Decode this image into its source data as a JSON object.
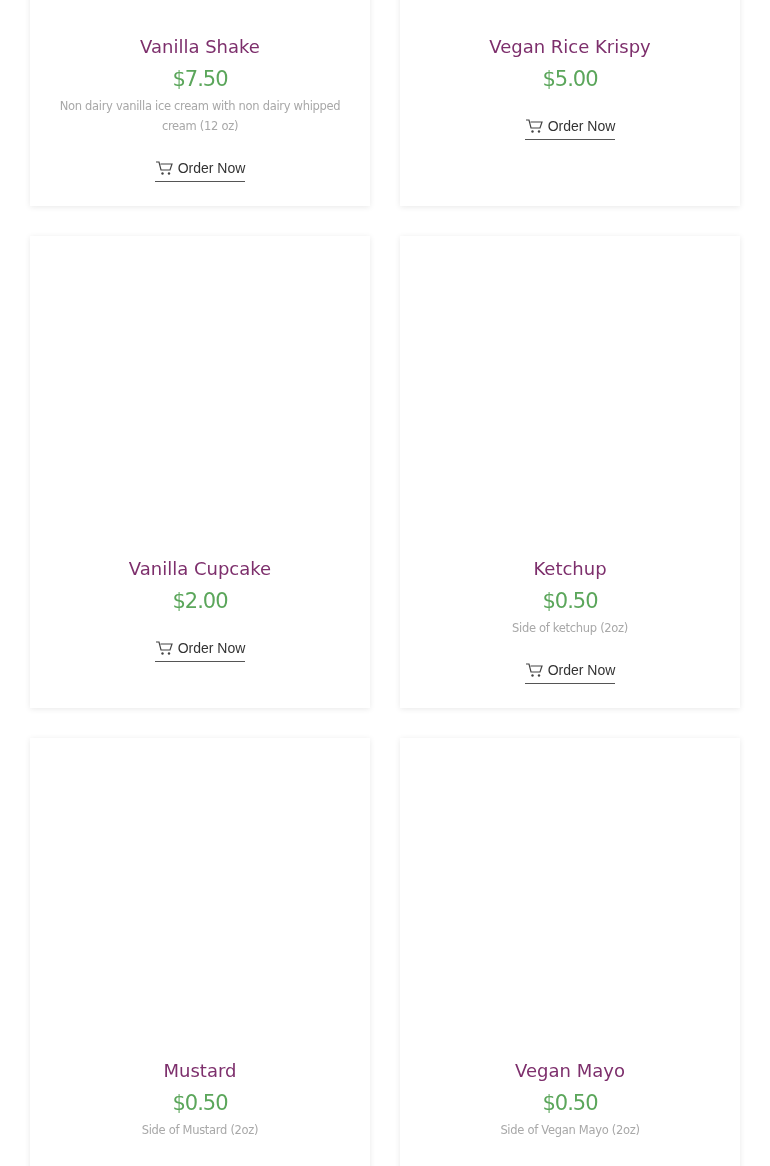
{
  "products": [
    {
      "name": "Vanilla Shake",
      "price": "$7.50",
      "description": "Non dairy vanilla ice cream with non dairy whipped cream (12 oz)",
      "button": "Order Now"
    },
    {
      "name": "Vegan Rice Krispy",
      "price": "$5.00",
      "button": "Order Now"
    },
    {
      "name": "Vanilla Cupcake",
      "price": "$2.00",
      "button": "Order Now"
    },
    {
      "name": "Ketchup",
      "price": "$0.50",
      "description": "Side of ketchup (2oz)",
      "button": "Order Now"
    },
    {
      "name": "Mustard",
      "price": "$0.50",
      "description": "Side of Mustard (2oz)"
    },
    {
      "name": "Vegan Mayo",
      "price": "$0.50",
      "description": "Side of Vegan Mayo (2oz)"
    }
  ]
}
